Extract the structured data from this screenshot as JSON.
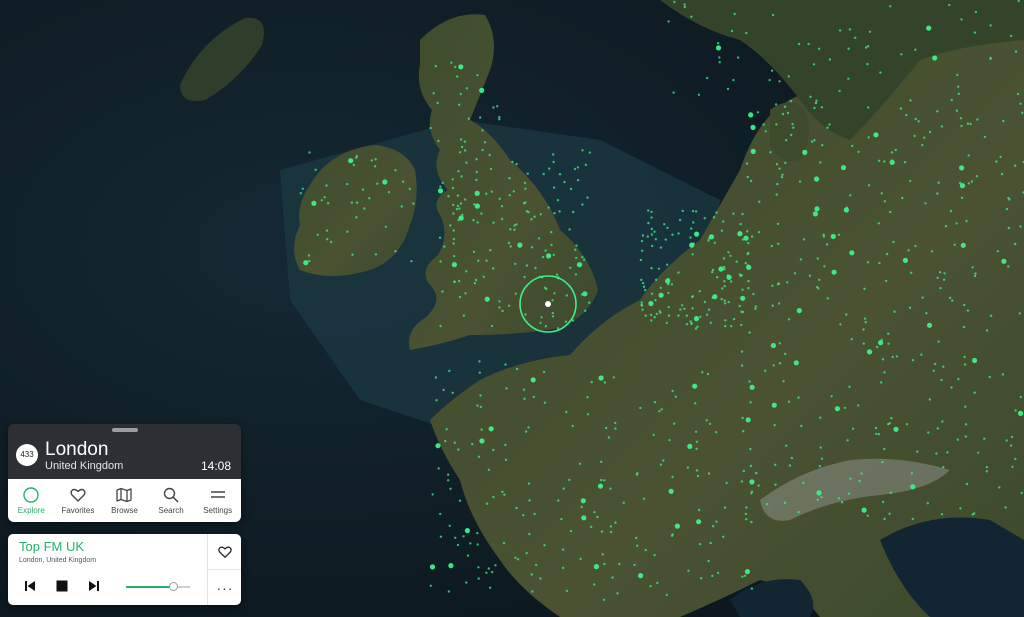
{
  "map": {
    "colors": {
      "ocean": "#0e1d27",
      "land": "#3a4a2a",
      "land_dark": "#2b3a22",
      "station": "#3ff08a",
      "focus_ring": "#3ff08a"
    },
    "focused_city": "London"
  },
  "location": {
    "station_count": "433",
    "city": "London",
    "country": "United Kingdom",
    "time": "14:08"
  },
  "nav": {
    "items": [
      {
        "id": "explore",
        "label": "Explore",
        "icon": "circle-icon",
        "active": true
      },
      {
        "id": "favorites",
        "label": "Favorites",
        "icon": "heart-icon",
        "active": false
      },
      {
        "id": "browse",
        "label": "Browse",
        "icon": "map-icon",
        "active": false
      },
      {
        "id": "search",
        "label": "Search",
        "icon": "search-icon",
        "active": false
      },
      {
        "id": "settings",
        "label": "Settings",
        "icon": "menu-icon",
        "active": false
      }
    ]
  },
  "player": {
    "station": "Top FM UK",
    "location": "London, United Kingdom",
    "volume": 0.75,
    "more_label": "···"
  },
  "accent": "#27b06a"
}
